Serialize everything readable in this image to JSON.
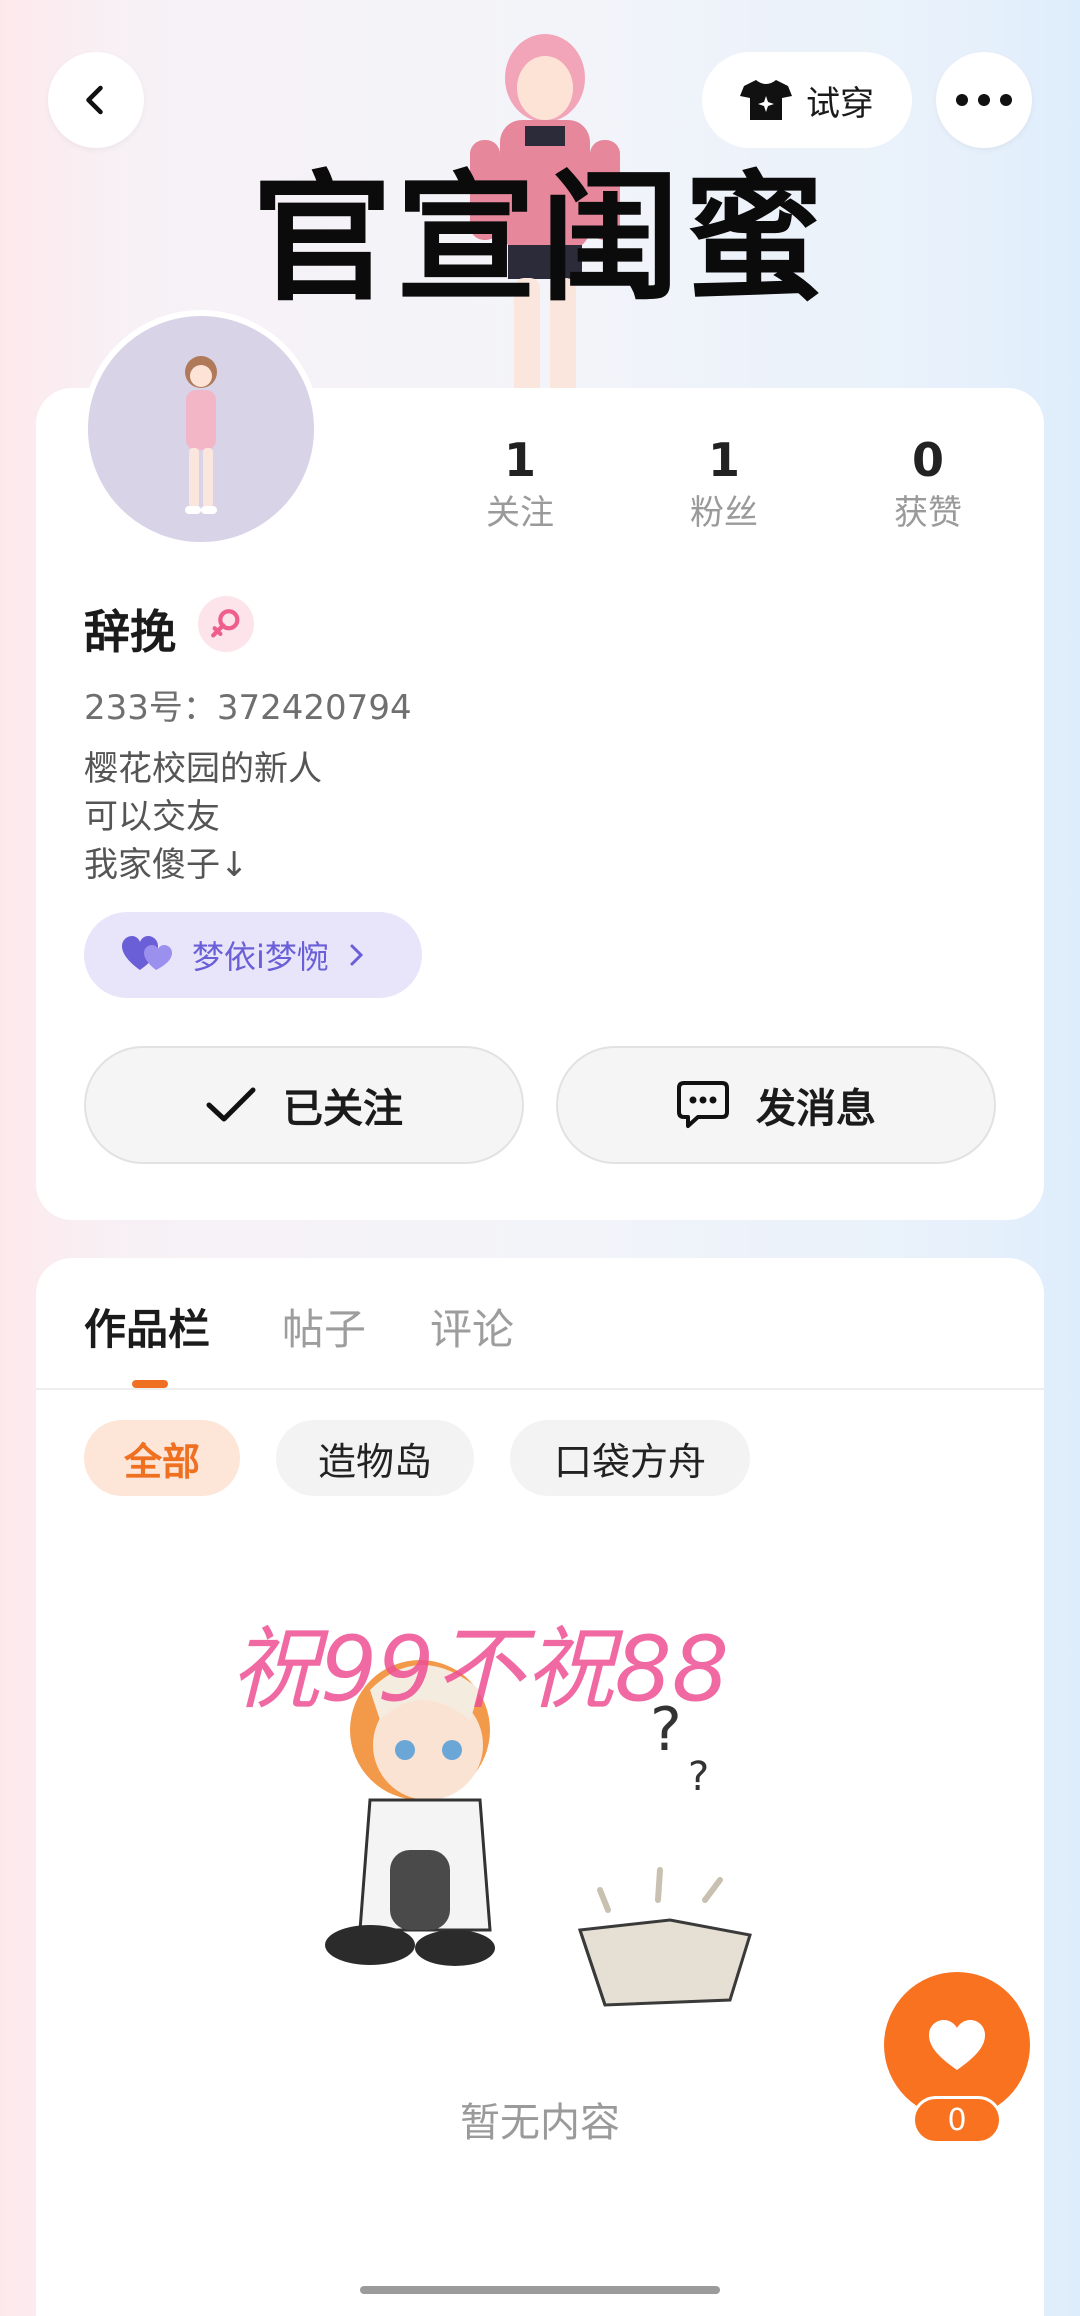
{
  "header": {
    "banner_title": "官宣闺蜜",
    "tryon_label": "试穿",
    "back_icon": "chevron-left-icon",
    "more_icon": "more-dots-icon",
    "tryon_icon": "tshirt-icon"
  },
  "profile": {
    "username": "辞挽",
    "gender": "female",
    "uid_text": "233号：372420794",
    "bio_lines": [
      "樱花校园的新人",
      "可以交友",
      "我家傻子↓"
    ],
    "bestie_label": "梦依i梦惋",
    "stats": [
      {
        "value": "1",
        "label": "关注"
      },
      {
        "value": "1",
        "label": "粉丝"
      },
      {
        "value": "0",
        "label": "获赞"
      }
    ],
    "follow_label": "已关注",
    "message_label": "发消息"
  },
  "works": {
    "tabs": [
      {
        "label": "作品栏",
        "active": true
      },
      {
        "label": "帖子",
        "active": false
      },
      {
        "label": "评论",
        "active": false
      }
    ],
    "filters": [
      {
        "label": "全部",
        "active": true
      },
      {
        "label": "造物岛",
        "active": false
      },
      {
        "label": "口袋方舟",
        "active": false
      }
    ],
    "watermark_text": "祝99不祝88",
    "empty_text": "暂无内容"
  },
  "like": {
    "count": "0"
  },
  "colors": {
    "accent": "#f07021",
    "fab": "#f87220",
    "bestie_text": "#6a5fd6",
    "bestie_bg": "#e8e5fb",
    "watermark": "#ee4f93"
  }
}
